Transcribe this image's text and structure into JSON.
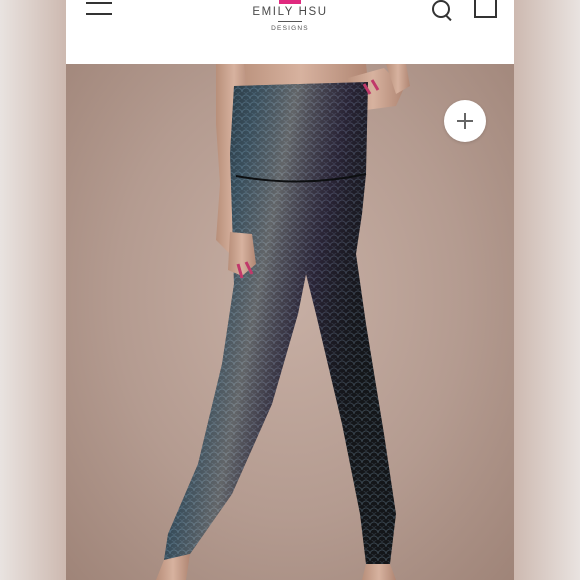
{
  "header": {
    "brand_name": "EMILY HSU",
    "brand_sub": "DESIGNS",
    "brand_color": "#e0297f",
    "menu_icon": "hamburger-icon",
    "search_icon": "search-icon",
    "bag_icon": "shopping-bag-icon"
  },
  "product_image": {
    "subject": "black holographic scale-print high-waist leggings",
    "zoom_icon": "plus-icon"
  }
}
